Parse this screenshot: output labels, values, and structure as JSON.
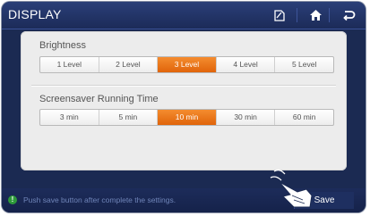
{
  "header": {
    "title": "DISPLAY",
    "icons": [
      "edit-icon",
      "home-icon",
      "back-icon"
    ]
  },
  "brightness": {
    "label": "Brightness",
    "options": [
      "1 Level",
      "2 Level",
      "3 Level",
      "4 Level",
      "5 Level"
    ],
    "selected": "3 Level"
  },
  "screensaver": {
    "label": "Screensaver Running Time",
    "options": [
      "3 min",
      "5 min",
      "10 min",
      "30 min",
      "60 min"
    ],
    "selected": "10 min"
  },
  "status": {
    "icon": "info-icon",
    "message": "Push save button after complete the settings.",
    "save_label": "Save"
  },
  "colors": {
    "background": "#1b2a52",
    "panel": "#ececec",
    "accent": "#f07a1c"
  }
}
